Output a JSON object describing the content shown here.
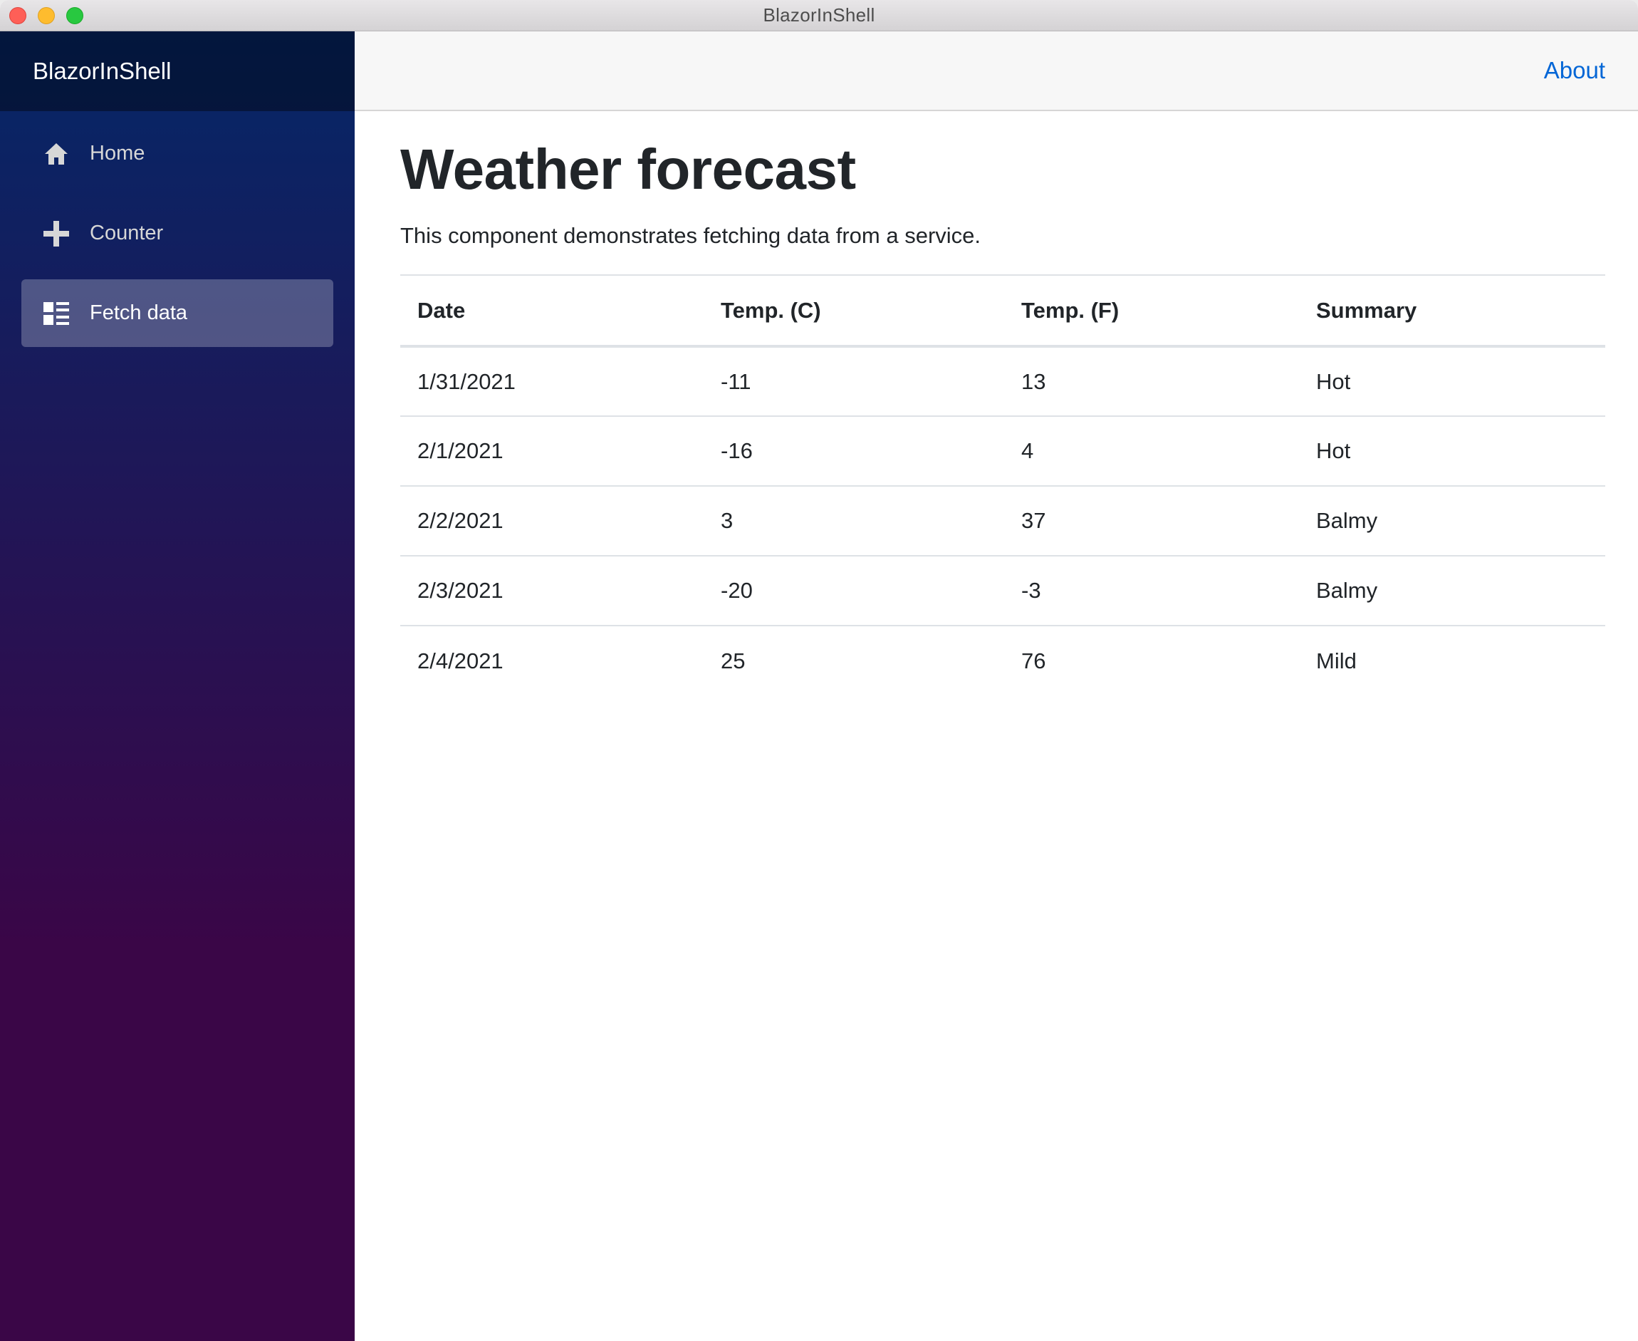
{
  "window": {
    "title": "BlazorInShell"
  },
  "sidebar": {
    "brand": "BlazorInShell",
    "items": [
      {
        "label": "Home",
        "icon": "home-icon",
        "active": false
      },
      {
        "label": "Counter",
        "icon": "plus-icon",
        "active": false
      },
      {
        "label": "Fetch data",
        "icon": "list-icon",
        "active": true
      }
    ]
  },
  "topbar": {
    "about_label": "About"
  },
  "main": {
    "title": "Weather forecast",
    "description": "This component demonstrates fetching data from a service.",
    "table": {
      "headers": [
        "Date",
        "Temp. (C)",
        "Temp. (F)",
        "Summary"
      ],
      "rows": [
        [
          "1/31/2021",
          "-11",
          "13",
          "Hot"
        ],
        [
          "2/1/2021",
          "-16",
          "4",
          "Hot"
        ],
        [
          "2/2/2021",
          "3",
          "37",
          "Balmy"
        ],
        [
          "2/3/2021",
          "-20",
          "-3",
          "Balmy"
        ],
        [
          "2/4/2021",
          "25",
          "76",
          "Mild"
        ]
      ]
    }
  },
  "colors": {
    "sidebar_top": "#052767",
    "sidebar_bottom": "#3a0647",
    "link": "#0366d6"
  }
}
